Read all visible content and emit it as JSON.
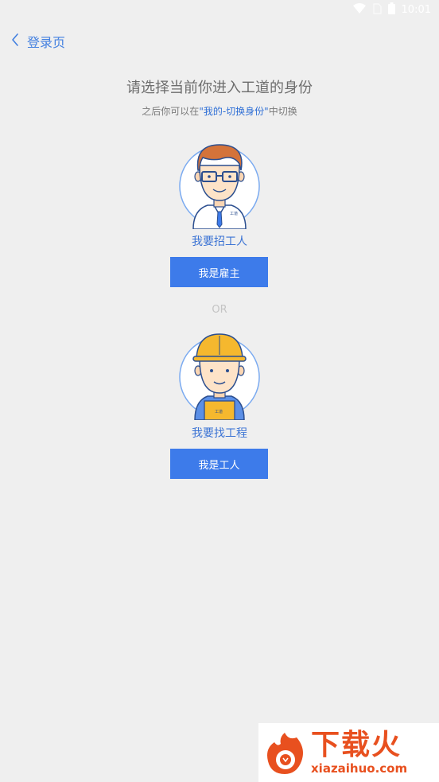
{
  "status_bar": {
    "time": "10:01"
  },
  "nav": {
    "back_label": "登录页"
  },
  "main": {
    "title": "请选择当前你进入工道的身份",
    "subtitle_prefix": "之后你可以在",
    "subtitle_highlight": "\"我的-切换身份\"",
    "subtitle_suffix": "中切换",
    "divider": "OR"
  },
  "roles": [
    {
      "label": "我要招工人",
      "button": "我是雇主",
      "badge": "工道"
    },
    {
      "label": "我要找工程",
      "button": "我是工人",
      "badge": "工道"
    }
  ],
  "watermark": {
    "name": "下载火",
    "url": "xiazaihuo.com"
  },
  "colors": {
    "accent": "#3d7bea",
    "link": "#4380e0",
    "background": "#efefef"
  }
}
